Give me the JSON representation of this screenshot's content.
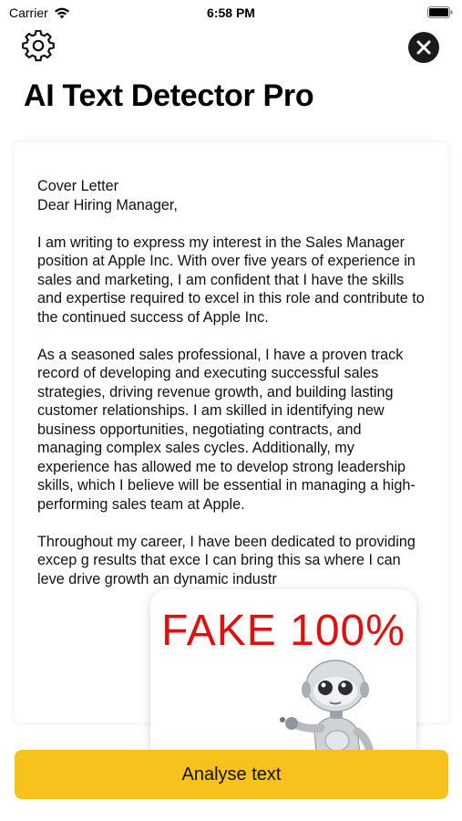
{
  "status_bar": {
    "carrier": "Carrier",
    "time": "6:58 PM"
  },
  "app": {
    "title": "AI Text Detector Pro"
  },
  "document": {
    "heading_lines": [
      "Cover Letter",
      "Dear Hiring Manager,"
    ],
    "paragraphs": [
      "I am writing to express my interest in the Sales Manager position at Apple Inc. With over five years of experience in sales and marketing, I am confident that I have the skills and expertise required to excel in this role and contribute to the continued success of Apple Inc.",
      "As a seasoned sales professional, I have a proven track record of developing and executing successful sales strategies, driving revenue growth, and building lasting customer relationships. I am skilled in identifying new business opportunities, negotiating contracts, and managing complex sales cycles. Additionally, my experience has allowed me to develop strong leadership skills, which I believe will be essential in managing a high-performing sales team at Apple.",
      "Throughout my career, I have been dedicated to providing excep g results that exce I can bring this sa where I can leve drive growth an dynamic industr"
    ]
  },
  "result": {
    "label": "FAKE  100%",
    "color": "#e01010"
  },
  "actions": {
    "analyse_label": "Analyse text"
  },
  "colors": {
    "button_yellow": "#f7c21c",
    "fake_red": "#e01010"
  },
  "icons": {
    "settings": "gear-icon",
    "close": "close-icon",
    "wifi": "wifi-icon",
    "battery": "battery-icon",
    "robot": "robot-icon"
  }
}
